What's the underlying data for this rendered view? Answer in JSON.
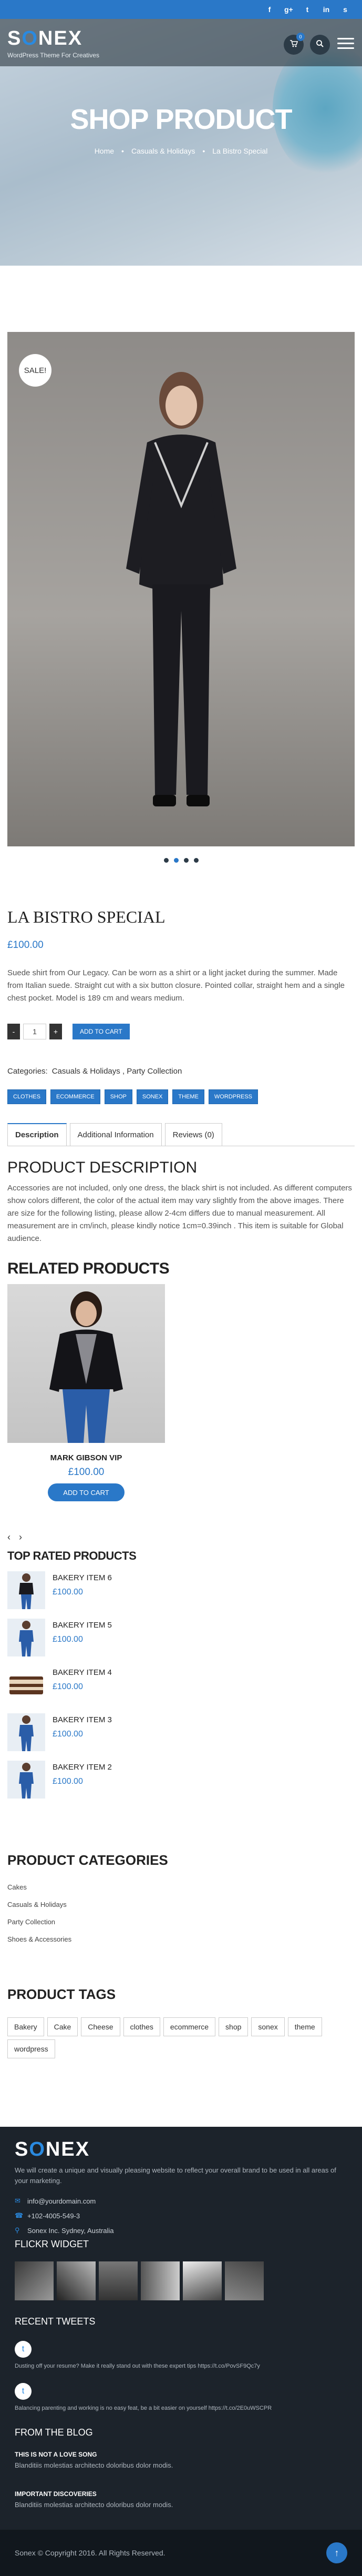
{
  "topbar": {
    "icons": [
      "facebook-icon",
      "google-plus-icon",
      "twitter-icon",
      "linkedin-icon",
      "skype-icon"
    ],
    "glyphs": [
      "f",
      "g+",
      "t",
      "in",
      "s"
    ]
  },
  "header": {
    "logo": "SONEX",
    "logo_s": "S",
    "logo_o": "O",
    "logo_rest": "NEX",
    "tagline": "WordPress Theme For Creatives",
    "cart_count": "0"
  },
  "hero": {
    "title": "SHOP PRODUCT",
    "breadcrumb": [
      "Home",
      "Casuals & Holidays",
      "La Bistro Special"
    ]
  },
  "product": {
    "sale_badge": "SALE!",
    "title": "LA BISTRO SPECIAL",
    "price": "£100.00",
    "description": "Suede shirt from Our Legacy. Can be worn as a shirt or a light jacket during the summer. Made from Italian suede. Straight cut with a six button closure. Pointed collar, straight hem and a single chest pocket. Model is 189 cm and wears medium.",
    "qty_minus": "-",
    "qty": "1",
    "qty_plus": "+",
    "add_to_cart": "ADD TO CART",
    "categories_label": "Categories:",
    "categories": "Casuals & Holidays ,  Party Collection",
    "tags": [
      "CLOTHES",
      "ECOMMERCE",
      "SHOP",
      "SONEX",
      "THEME",
      "WORDPRESS"
    ]
  },
  "tabs": {
    "items": [
      "Description",
      "Additional Information",
      "Reviews (0)"
    ]
  },
  "description": {
    "heading": "PRODUCT DESCRIPTION",
    "text": "Accessories are not included, only one dress, the black shirt is not included. As different computers show colors different, the color of the actual item may vary slightly from the above images. There are size for the following listing, please allow 2-4cm differs due to manual measurement. All measurement are in cm/inch, please kindly notice 1cm=0.39inch . This item is suitable for Global audience."
  },
  "related": {
    "heading": "RELATED PRODUCTS",
    "name": "MARK GIBSON VIP",
    "price": "£100.00",
    "button": "ADD TO CART"
  },
  "top_rated": {
    "heading": "TOP RATED PRODUCTS",
    "items": [
      {
        "name": "BAKERY ITEM 6",
        "price": "£100.00"
      },
      {
        "name": "BAKERY ITEM 5",
        "price": "£100.00"
      },
      {
        "name": "BAKERY ITEM 4",
        "price": "£100.00"
      },
      {
        "name": "BAKERY ITEM 3",
        "price": "£100.00"
      },
      {
        "name": "BAKERY ITEM 2",
        "price": "£100.00"
      }
    ]
  },
  "product_categories": {
    "heading": "PRODUCT CATEGORIES",
    "items": [
      "Cakes",
      "Casuals & Holidays",
      "Party Collection",
      "Shoes & Accessories"
    ]
  },
  "product_tags": {
    "heading": "PRODUCT TAGS",
    "items": [
      "Bakery",
      "Cake",
      "Cheese",
      "clothes",
      "ecommerce",
      "shop",
      "sonex",
      "theme",
      "wordpress"
    ]
  },
  "footer": {
    "logo_s": "S",
    "logo_o": "O",
    "logo_rest": "NEX",
    "about": "We will create a unique and visually pleasing website to reflect your overall brand to be used in all areas of your marketing.",
    "email": "info@yourdomain.com",
    "phone": "+102-4005-549-3",
    "address": "Sonex Inc. Sydney, Australia",
    "flickr_heading": "FLICKR WIDGET",
    "tweets_heading": "RECENT TWEETS",
    "tweets": [
      "Dusting off your resume? Make it really stand out with these expert tips https://t.co/PovSF9Qc7y",
      "Balancing parenting and working is no easy feat, be a bit easier on yourself https://t.co/2E0uWSCPR"
    ],
    "blog_heading": "FROM THE BLOG",
    "posts": [
      {
        "title": "THIS IS NOT A LOVE SONG",
        "snippet": "Blanditiis molestias architecto doloribus dolor modis."
      },
      {
        "title": "IMPORTANT DISCOVERIES",
        "snippet": "Blanditiis molestias architecto doloribus dolor modis."
      }
    ],
    "copyright": "Sonex © Copyright 2016. All Rights Reserved."
  }
}
